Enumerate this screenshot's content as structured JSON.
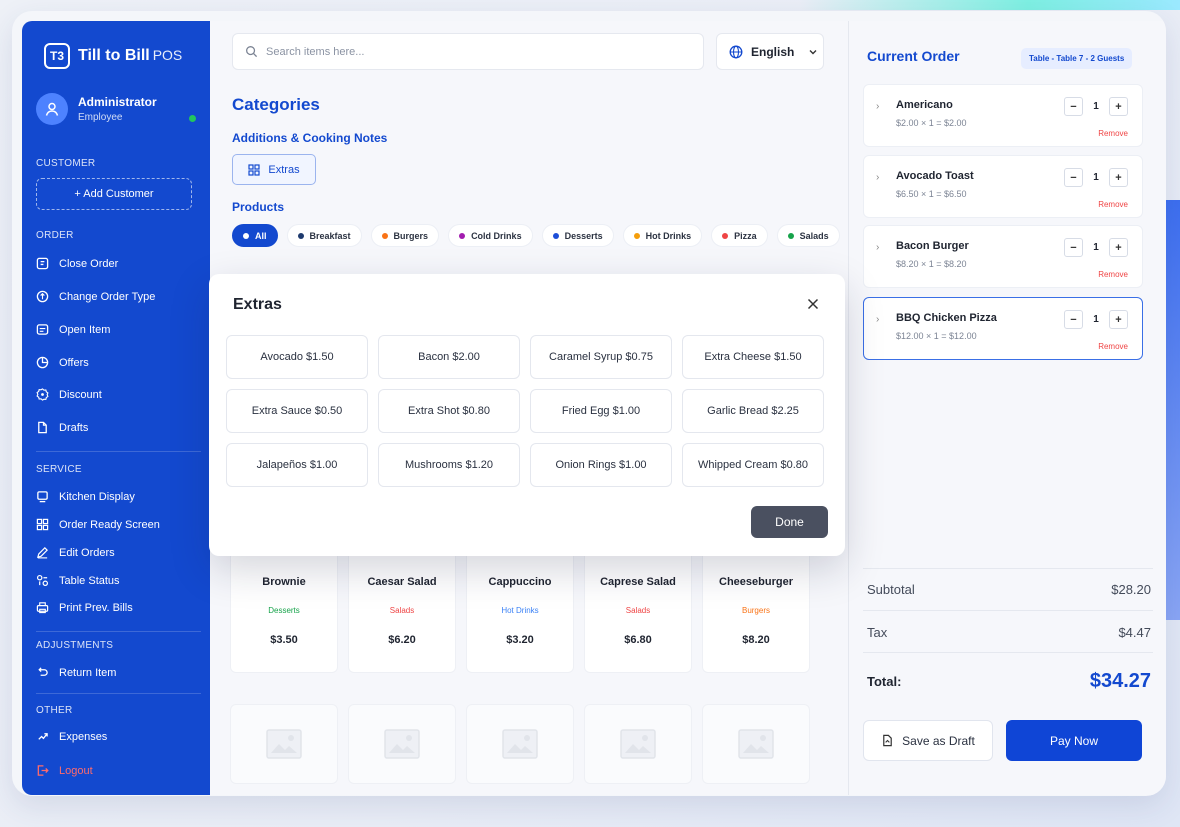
{
  "brand": {
    "logo": "T3",
    "name": "Till to Bill",
    "suffix": "POS"
  },
  "user": {
    "name": "Administrator",
    "role": "Employee"
  },
  "sidebar": {
    "sections": {
      "customer": "CUSTOMER",
      "order": "ORDER",
      "service": "SERVICE",
      "adjustments": "ADJUSTMENTS",
      "other": "OTHER"
    },
    "add_customer": "+ Add Customer",
    "order_items": [
      "Close Order",
      "Change Order Type",
      "Open Item",
      "Offers",
      "Discount",
      "Drafts"
    ],
    "service_items": [
      "Kitchen Display",
      "Order Ready Screen",
      "Edit Orders",
      "Table Status",
      "Print Prev. Bills"
    ],
    "adjustment_items": [
      "Return Item"
    ],
    "other_items": [
      "Expenses"
    ],
    "logout": "Logout"
  },
  "search": {
    "placeholder": "Search items here..."
  },
  "language": {
    "selected": "English"
  },
  "categories": {
    "title": "Categories",
    "sub_title": "Additions & Cooking Notes",
    "extras_label": "Extras"
  },
  "products": {
    "title": "Products",
    "filters": [
      {
        "label": "All",
        "color": "#ffffff"
      },
      {
        "label": "Breakfast",
        "color": "#1e3a6e"
      },
      {
        "label": "Burgers",
        "color": "#f97316"
      },
      {
        "label": "Cold Drinks",
        "color": "#a21caf"
      },
      {
        "label": "Desserts",
        "color": "#1d4ed8"
      },
      {
        "label": "Hot Drinks",
        "color": "#f59e0b"
      },
      {
        "label": "Pizza",
        "color": "#ef4444"
      },
      {
        "label": "Salads",
        "color": "#16a34a"
      }
    ],
    "items": [
      {
        "name": "Brownie",
        "category": "Desserts",
        "category_color": "#16a34a",
        "price": "$3.50"
      },
      {
        "name": "Caesar Salad",
        "category": "Salads",
        "category_color": "#ef4444",
        "price": "$6.20"
      },
      {
        "name": "Cappuccino",
        "category": "Hot Drinks",
        "category_color": "#3b82f6",
        "price": "$3.20"
      },
      {
        "name": "Caprese Salad",
        "category": "Salads",
        "category_color": "#ef4444",
        "price": "$6.80"
      },
      {
        "name": "Cheeseburger",
        "category": "Burgers",
        "category_color": "#f97316",
        "price": "$8.20"
      }
    ]
  },
  "modal": {
    "title": "Extras",
    "options": [
      "Avocado $1.50",
      "Bacon $2.00",
      "Caramel Syrup $0.75",
      "Extra Cheese $1.50",
      "Extra Sauce $0.50",
      "Extra Shot $0.80",
      "Fried Egg $1.00",
      "Garlic Bread $2.25",
      "Jalapeños $1.00",
      "Mushrooms $1.20",
      "Onion Rings $1.00",
      "Whipped Cream $0.80"
    ],
    "done_label": "Done"
  },
  "order": {
    "title": "Current Order",
    "table_badge": "Table - Table 7 - 2 Guests",
    "items": [
      {
        "name": "Americano",
        "detail": "$2.00 × 1 = $2.00",
        "qty": "1"
      },
      {
        "name": "Avocado Toast",
        "detail": "$6.50 × 1 = $6.50",
        "qty": "1"
      },
      {
        "name": "Bacon Burger",
        "detail": "$8.20 × 1 = $8.20",
        "qty": "1"
      },
      {
        "name": "BBQ Chicken Pizza",
        "detail": "$12.00 × 1 = $12.00",
        "qty": "1"
      }
    ],
    "remove_label": "Remove",
    "subtotal_label": "Subtotal",
    "subtotal": "$28.20",
    "tax_label": "Tax",
    "tax": "$4.47",
    "total_label": "Total:",
    "total": "$34.27",
    "draft_label": "Save as Draft",
    "pay_label": "Pay Now"
  },
  "colors": {
    "brand": "#1349cf",
    "accent": "#0f45d6",
    "danger": "#ef4444"
  }
}
